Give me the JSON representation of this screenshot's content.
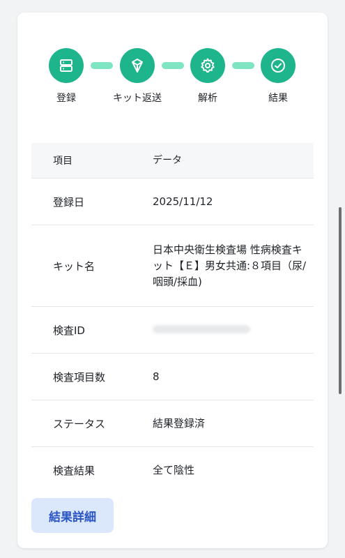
{
  "colors": {
    "step_circle": "#1fb58c",
    "connector": "#7fe4c2",
    "button_bg": "#dbe8fb",
    "button_text": "#2a55c4"
  },
  "steps": [
    {
      "label": "登録",
      "icon": "server-icon"
    },
    {
      "label": "キット返送",
      "icon": "shield-icon"
    },
    {
      "label": "解析",
      "icon": "gear-icon"
    },
    {
      "label": "結果",
      "icon": "check-circle-icon"
    }
  ],
  "table": {
    "headers": [
      "項目",
      "データ"
    ],
    "rows": [
      {
        "label": "登録日",
        "value": "2025/11/12"
      },
      {
        "label": "キット名",
        "value": "日本中央衛生検査場 性病検査キット【Ｅ】男女共通:８項目（尿/咽頭/採血)"
      },
      {
        "label": "検査ID",
        "value": ""
      },
      {
        "label": "検査項目数",
        "value": "8"
      },
      {
        "label": "ステータス",
        "value": "結果登録済"
      },
      {
        "label": "検査結果",
        "value": "全て陰性"
      }
    ]
  },
  "actions": {
    "detail_button": "結果詳細"
  }
}
